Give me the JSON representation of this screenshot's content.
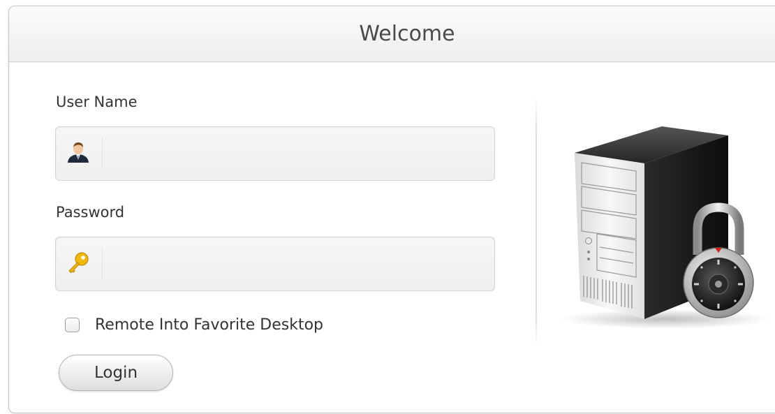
{
  "dialog": {
    "title": "Welcome"
  },
  "form": {
    "username_label": "User Name",
    "username_value": "",
    "username_icon": "user-icon",
    "password_label": "Password",
    "password_value": "",
    "password_icon": "key-icon",
    "remote_checkbox_label": "Remote Into Favorite Desktop",
    "remote_checkbox_checked": false,
    "login_button_label": "Login"
  },
  "illustration": {
    "icon": "locked-server-icon"
  }
}
